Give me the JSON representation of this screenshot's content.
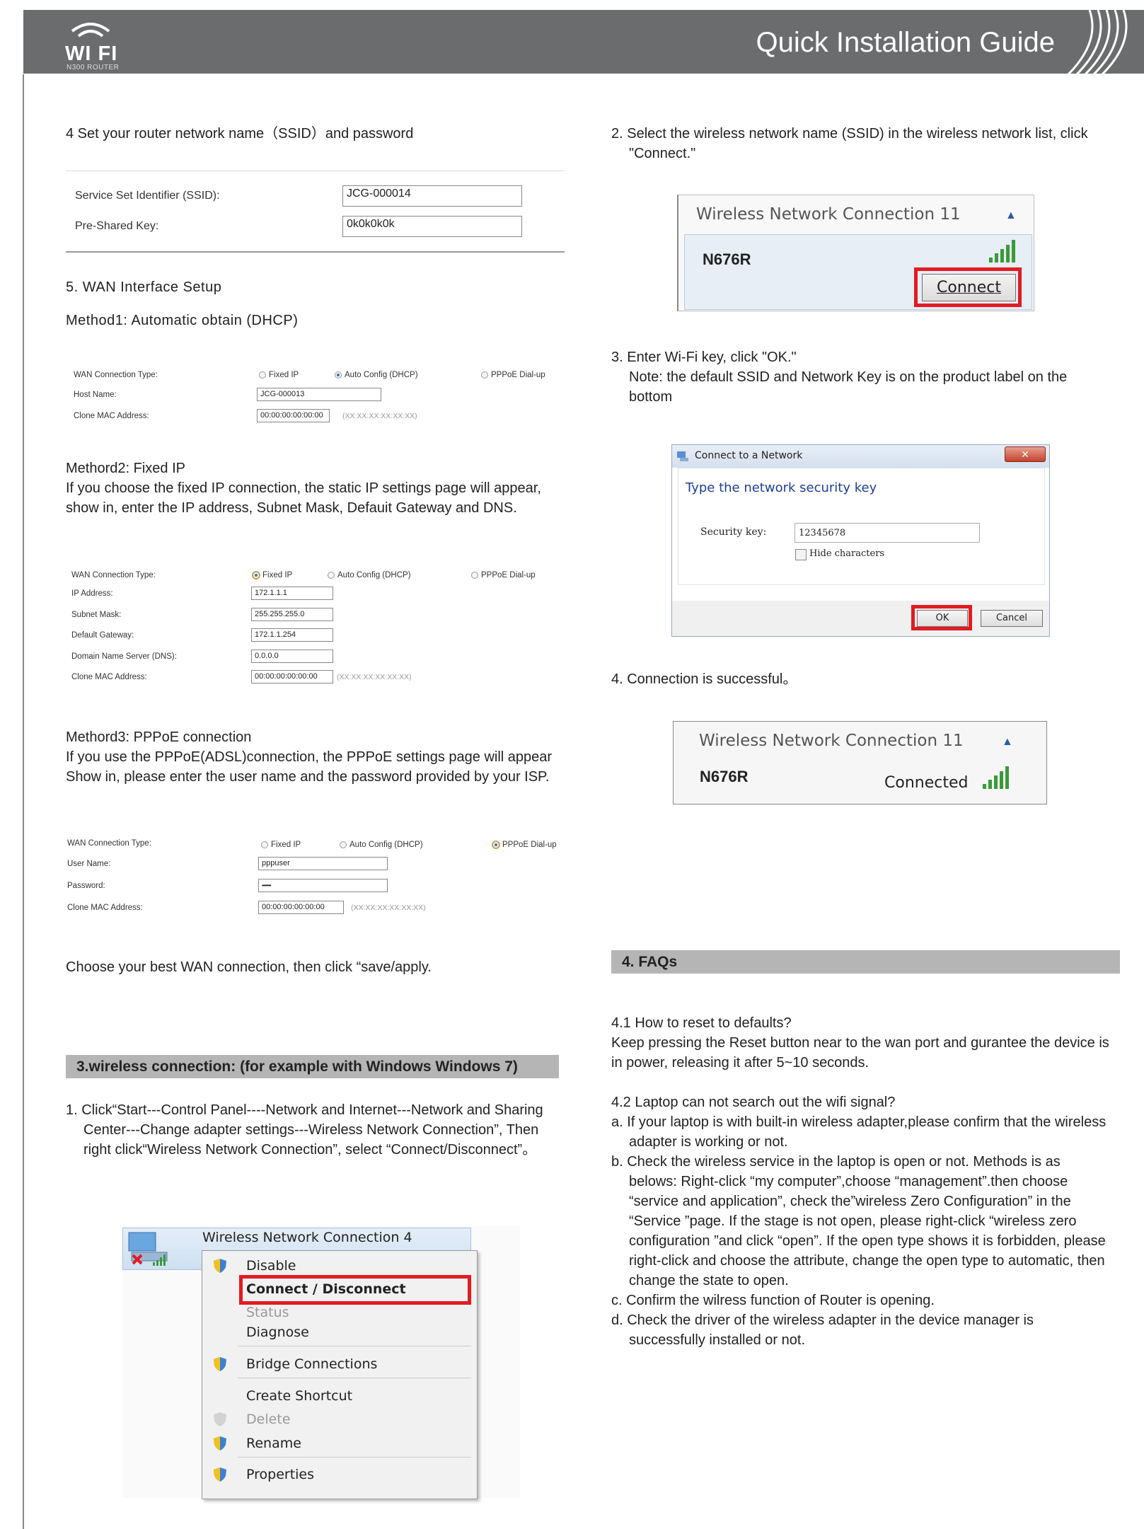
{
  "header": {
    "logo_text": "WI FI",
    "logo_sub": "N300 ROUTER",
    "title": "Quick Installation Guide"
  },
  "left": {
    "step4_title": "4  Set your router network name（SSID）and password",
    "ssid_form": {
      "ssid_label": "Service Set Identifier (SSID):",
      "ssid_value": "JCG-000014",
      "psk_label": "Pre-Shared Key:",
      "psk_value": "0k0k0k0k"
    },
    "step5_title": "5. WAN Interface Setup",
    "method1_title": "Method1: Automatic obtain (DHCP)",
    "dhcp_form": {
      "type_label": "WAN Connection Type:",
      "opt_fixed": "Fixed IP",
      "opt_auto": "Auto Config (DHCP)",
      "opt_pppoe": "PPPoE Dial-up",
      "host_label": "Host Name:",
      "host_value": "JCG-000013",
      "mac_label": "Clone MAC Address:",
      "mac_value": "00:00:00:00:00:00",
      "mac_hint": "(XX:XX:XX:XX:XX:XX)"
    },
    "method2_title": "Methord2: Fixed IP",
    "method2_text": "If you choose the fixed IP connection, the static IP settings page will appear, show in, enter the IP address, Subnet Mask, Defauit Gateway and DNS.",
    "fixed_form": {
      "type_label": "WAN Connection Type:",
      "opt_fixed": "Fixed IP",
      "opt_auto": "Auto Config (DHCP)",
      "opt_pppoe": "PPPoE Dial-up",
      "ip_label": "IP Address:",
      "ip_value": "172.1.1.1",
      "mask_label": "Subnet Mask:",
      "mask_value": "255.255.255.0",
      "gw_label": "Default Gateway:",
      "gw_value": "172.1.1.254",
      "dns_label": "Domain Name Server (DNS):",
      "dns_value": "0.0.0.0",
      "mac_label": "Clone MAC Address:",
      "mac_value": "00:00:00:00:00:00",
      "mac_hint": "(XX:XX:XX:XX:XX:XX)"
    },
    "method3_title": "Methord3: PPPoE connection",
    "method3_text": "If you use the PPPoE(ADSL)connection, the PPPoE settings page will appear Show in, please enter the user name and the password provided by your ISP.",
    "pppoe_form": {
      "type_label": "WAN Connection Type:",
      "opt_fixed": "Fixed IP",
      "opt_auto": "Auto Config (DHCP)",
      "opt_pppoe": "PPPoE Dial-up",
      "user_label": "User Name:",
      "user_value": "pppuser",
      "pass_label": "Password:",
      "pass_value": "•••••••",
      "mac_label": "Clone MAC Address:",
      "mac_value": "00:00:00:00:00:00",
      "mac_hint": "(XX:XX:XX:XX:XX:XX)"
    },
    "choose_text": "Choose your best WAN connection, then click “save/apply.",
    "section3_title": "3.wireless connection: (for example with Windows Windows 7)",
    "step1_text": "1. Click“Start---Control Panel----Network and Internet---Network and Sharing Center---Change adapter settings---Wireless Network Connection”, Then  right  click“Wireless  Network Connection”, select “Connect/Disconnect”。",
    "context_menu": {
      "adapter_title": "Wireless Network Connection 4",
      "items": [
        "Disable",
        "Connect / Disconnect",
        "Status",
        "Diagnose",
        "Bridge Connections",
        "Create Shortcut",
        "Delete",
        "Rename",
        "Properties"
      ]
    }
  },
  "right": {
    "step2_text": "2. Select the wireless network name (SSID) in the wireless network list, click \"Connect.\"",
    "net_popup": {
      "title": "Wireless Network Connection 11",
      "network": "N676R",
      "connect_btn": "Connect"
    },
    "step3_line1": "3. Enter Wi-Fi key, click \"OK.\"",
    "step3_line2": "Note: the default SSID and Network Key is  on  the product label on the bottom",
    "dialog": {
      "title": "Connect to a Network",
      "heading": "Type the network security key",
      "key_label": "Security key:",
      "key_value": "12345678",
      "hide_label": "Hide characters",
      "ok": "OK",
      "cancel": "Cancel"
    },
    "step4_text": "4. Connection is successful。",
    "connected_popup": {
      "title": "Wireless Network Connection 11",
      "network": "N676R",
      "status": "Connected"
    },
    "faq_title": "4. FAQs",
    "faq1_q": "4.1 How to reset to defaults?",
    "faq1_a": "Keep pressing the Reset button near to the wan port and gurantee the device is in power, releasing it after 5~10 seconds.",
    "faq2_q": "4.2 Laptop can not search out the wifi signal?",
    "faq2_a": "a. If your laptop is with built-in wireless adapter,please confirm that the wireless adapter is working or not.",
    "faq2_b": "b. Check the wireless service in the laptop is open or not. Methods is as belows: Right-click “my computer”,choose “management”.then choose “service and application”, check the”wireless Zero Configuration” in the “Service ”page. If the stage is not open, please right-click “wireless zero configuration ”and click “open”. If the open type shows it is forbidden, please right-click and choose the attribute, change the open type to automatic, then change the state to open.",
    "faq2_c": "c. Confirm the wilress function of Router is opening.",
    "faq2_d": "d. Check the driver of the wireless adapter in the device manager is successfully installed or not."
  }
}
